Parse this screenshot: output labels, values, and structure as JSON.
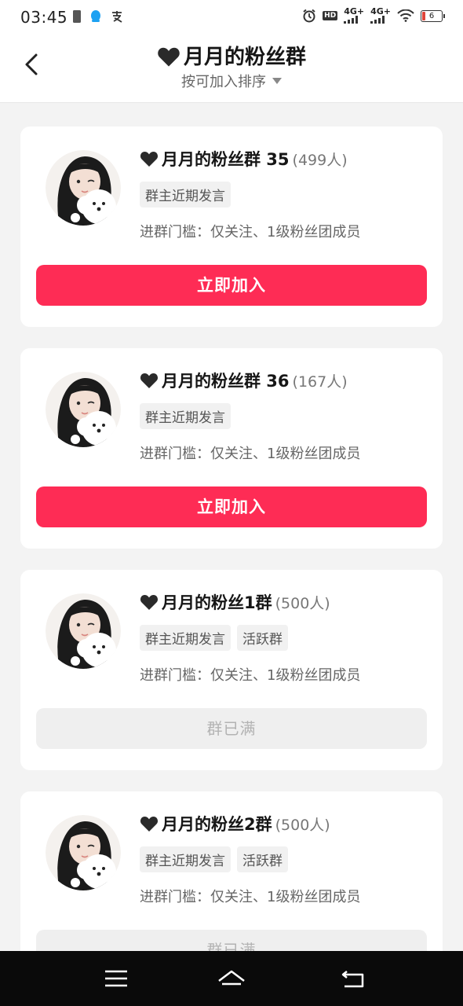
{
  "status_bar": {
    "time": "03:45",
    "network_1": "4G+",
    "network_2": "4G+",
    "hd_label": "HD",
    "battery_level": "6"
  },
  "header": {
    "title": "月月的粉丝群",
    "sort_label": "按可加入排序"
  },
  "groups": [
    {
      "name": "月月的粉丝群 35",
      "count": "(499人)",
      "tags": [
        "群主近期发言"
      ],
      "threshold": "进群门槛：仅关注、1级粉丝团成员",
      "action": "立即加入"
    },
    {
      "name": "月月的粉丝群 36",
      "count": "(167人)",
      "tags": [
        "群主近期发言"
      ],
      "threshold": "进群门槛：仅关注、1级粉丝团成员",
      "action": "立即加入"
    },
    {
      "name": "月月的粉丝1群",
      "count": "(500人)",
      "tags": [
        "群主近期发言",
        "活跃群"
      ],
      "threshold": "进群门槛：仅关注、1级粉丝团成员",
      "action": "群已满"
    },
    {
      "name": "月月的粉丝2群",
      "count": "(500人)",
      "tags": [
        "群主近期发言",
        "活跃群"
      ],
      "threshold": "进群门槛：仅关注、1级粉丝团成员",
      "action": "群已满"
    }
  ],
  "icons": {
    "back": "back-chevron-icon",
    "heart": "black-heart-icon",
    "menu": "menu-icon",
    "home": "home-icon",
    "return": "return-icon"
  },
  "colors": {
    "accent": "#fe2c55",
    "disabled_bg": "#efefef",
    "disabled_text": "#b3b3b3"
  }
}
